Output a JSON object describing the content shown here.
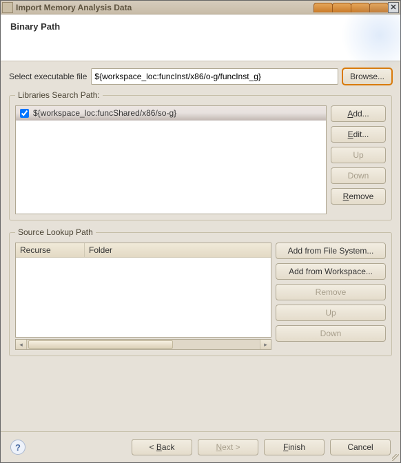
{
  "window": {
    "title": "Import Memory Analysis Data"
  },
  "header": {
    "title": "Binary Path"
  },
  "exec": {
    "label": "Select executable file",
    "value": "${workspace_loc:funcInst/x86/o-g/funcInst_g}",
    "browse": "Browse..."
  },
  "libs": {
    "legend": "Libraries Search Path:",
    "items": [
      {
        "checked": true,
        "path": "${workspace_loc:funcShared/x86/so-g}"
      }
    ],
    "buttons": {
      "add": "Add...",
      "edit": "Edit...",
      "up": "Up",
      "down": "Down",
      "remove": "Remove"
    }
  },
  "source": {
    "legend": "Source Lookup Path",
    "columns": {
      "recurse": "Recurse",
      "folder": "Folder"
    },
    "buttons": {
      "add_fs": "Add from File System...",
      "add_ws": "Add from Workspace...",
      "remove": "Remove",
      "up": "Up",
      "down": "Down"
    }
  },
  "wizard": {
    "back": "Back",
    "next": "Next >",
    "finish": "Finish",
    "cancel": "Cancel"
  },
  "icons": {
    "help": "?",
    "close": "✕",
    "left": "◂",
    "right": "▸"
  }
}
